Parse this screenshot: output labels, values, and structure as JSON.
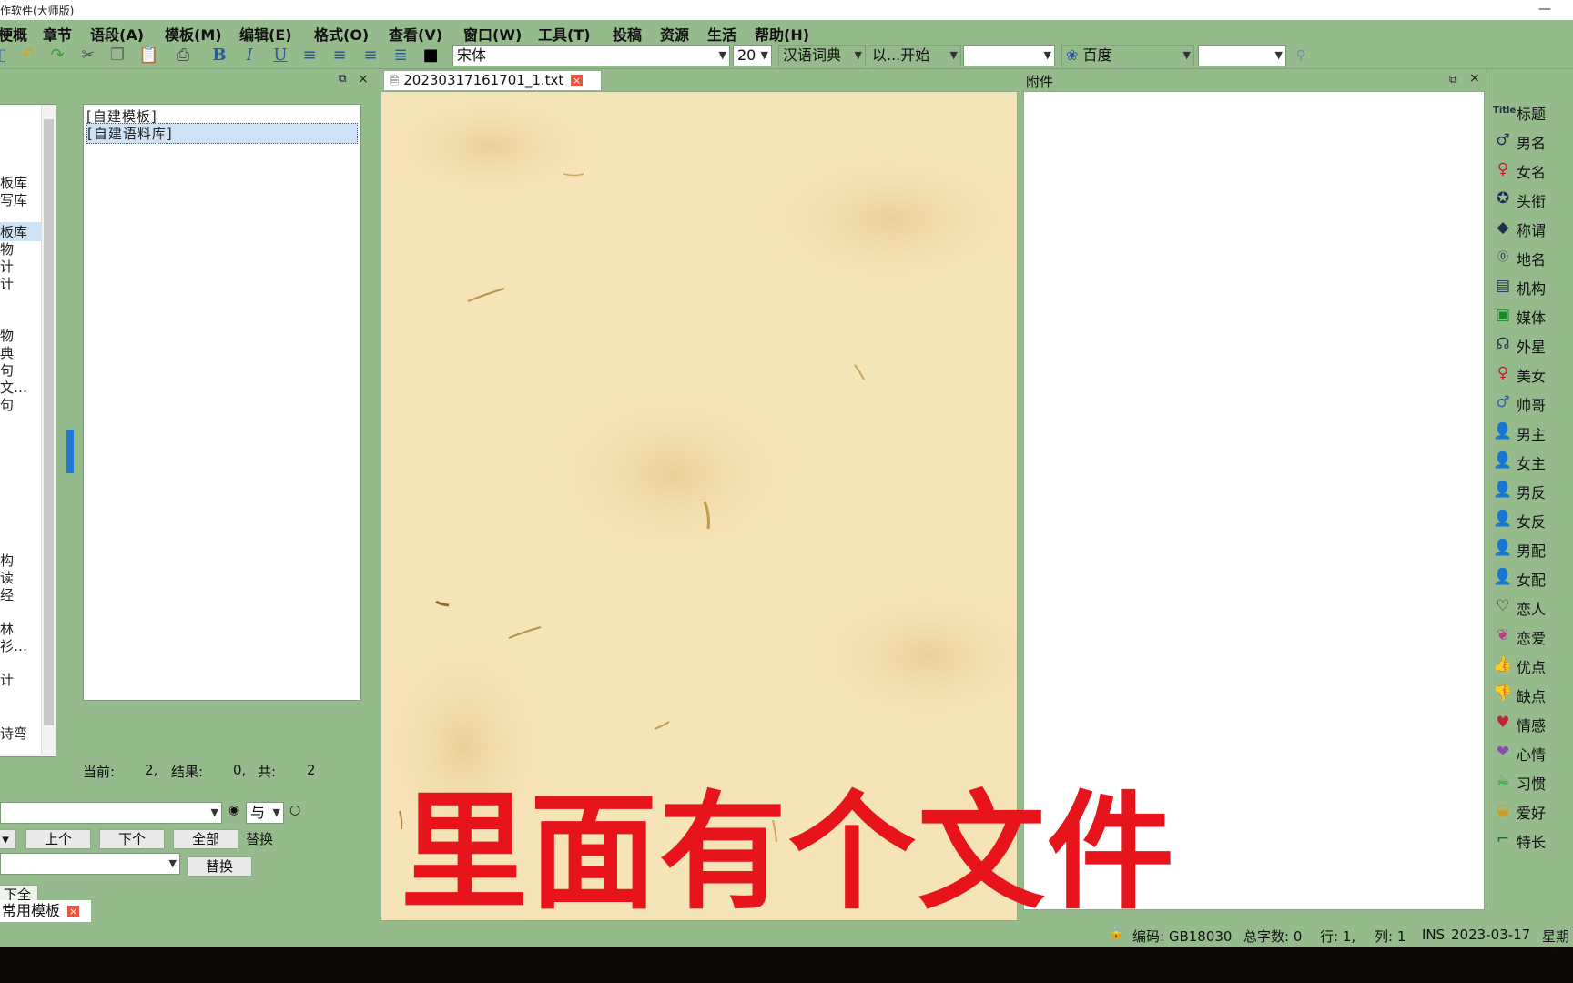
{
  "window": {
    "title": "作软件(大师版)",
    "minimize_glyph": "—"
  },
  "menu": {
    "items": [
      "梗概",
      "章节",
      "语段(A)",
      "模板(M)",
      "编辑(E)",
      "格式(O)",
      "查看(V)",
      "窗口(W)",
      "工具(T)",
      "投稿",
      "资源",
      "生活",
      "帮助(H)"
    ]
  },
  "toolbar": {
    "icons": [
      "new-icon",
      "undo-icon",
      "redo-icon",
      "cut-icon",
      "copy-icon",
      "paste-icon",
      "print-icon",
      "bold-icon",
      "italic-icon",
      "underline-icon",
      "align-left-icon",
      "align-center-icon",
      "align-right-icon",
      "justify-icon",
      "color-icon"
    ],
    "font_name": "宋体",
    "font_size": "20",
    "dict": "汉语词典",
    "match_mode": "以...开始",
    "dict_query": "",
    "search_engine": "百度",
    "search_query": ""
  },
  "left_panel": {
    "tree_items": [
      "板库",
      "写库",
      "板库",
      "物",
      "计",
      "计",
      "物",
      "典",
      "句",
      "文…",
      "句",
      "构",
      "读",
      "经",
      "林",
      "衫…",
      "计",
      "诗弯"
    ],
    "list_items": [
      "[自建模板]",
      "[自建语料库]"
    ],
    "status": {
      "current_label": "当前:",
      "current": "2,",
      "result_label": "结果:",
      "result": "0,",
      "total_label": "共:",
      "total": "2"
    },
    "search_value": "",
    "logic_op": "与",
    "prev_label": "上个",
    "next_label": "下个",
    "all_label": "全部",
    "replace_label": "替换",
    "replace_button": "替换",
    "replace_all_label": "下全部"
  },
  "document": {
    "tab_title": "20230317161701_1.txt"
  },
  "attachment": {
    "title": "附件"
  },
  "sidebar": {
    "items": [
      {
        "label": "标题",
        "icon": "title-icon"
      },
      {
        "label": "男名",
        "icon": "male-name-icon"
      },
      {
        "label": "女名",
        "icon": "female-name-icon"
      },
      {
        "label": "头衔",
        "icon": "badge-icon"
      },
      {
        "label": "称谓",
        "icon": "tag-icon"
      },
      {
        "label": "地名",
        "icon": "place-icon"
      },
      {
        "label": "机构",
        "icon": "organization-icon"
      },
      {
        "label": "媒体",
        "icon": "media-icon"
      },
      {
        "label": "外星",
        "icon": "alien-icon"
      },
      {
        "label": "美女",
        "icon": "female-icon"
      },
      {
        "label": "帅哥",
        "icon": "male-icon"
      },
      {
        "label": "男主",
        "icon": "hero-icon"
      },
      {
        "label": "女主",
        "icon": "heroine-icon"
      },
      {
        "label": "男反",
        "icon": "male-villain-icon"
      },
      {
        "label": "女反",
        "icon": "female-villain-icon"
      },
      {
        "label": "男配",
        "icon": "male-support-icon"
      },
      {
        "label": "女配",
        "icon": "female-support-icon"
      },
      {
        "label": "恋人",
        "icon": "heart-icon"
      },
      {
        "label": "恋爱",
        "icon": "couple-icon"
      },
      {
        "label": "优点",
        "icon": "thumbs-up-icon"
      },
      {
        "label": "缺点",
        "icon": "thumbs-down-icon"
      },
      {
        "label": "情感",
        "icon": "emotion-icon"
      },
      {
        "label": "心情",
        "icon": "mood-icon"
      },
      {
        "label": "习惯",
        "icon": "cup-icon"
      },
      {
        "label": "爱好",
        "icon": "hobby-icon"
      },
      {
        "label": "特长",
        "icon": "stairs-icon"
      }
    ]
  },
  "bottom_tab": {
    "label": "常用模板"
  },
  "statusbar": {
    "encoding": "编码: GB18030",
    "word_count": "总字数: 0",
    "line": "行: 1,",
    "column": "列: 1",
    "ins": "INS",
    "date": "2023-03-17",
    "weekday": "星期"
  },
  "caption": "里面有个文件",
  "colors": {
    "app_bg": "#95bb8d",
    "paper": "#f5e2b6",
    "caption": "#e8141c"
  }
}
